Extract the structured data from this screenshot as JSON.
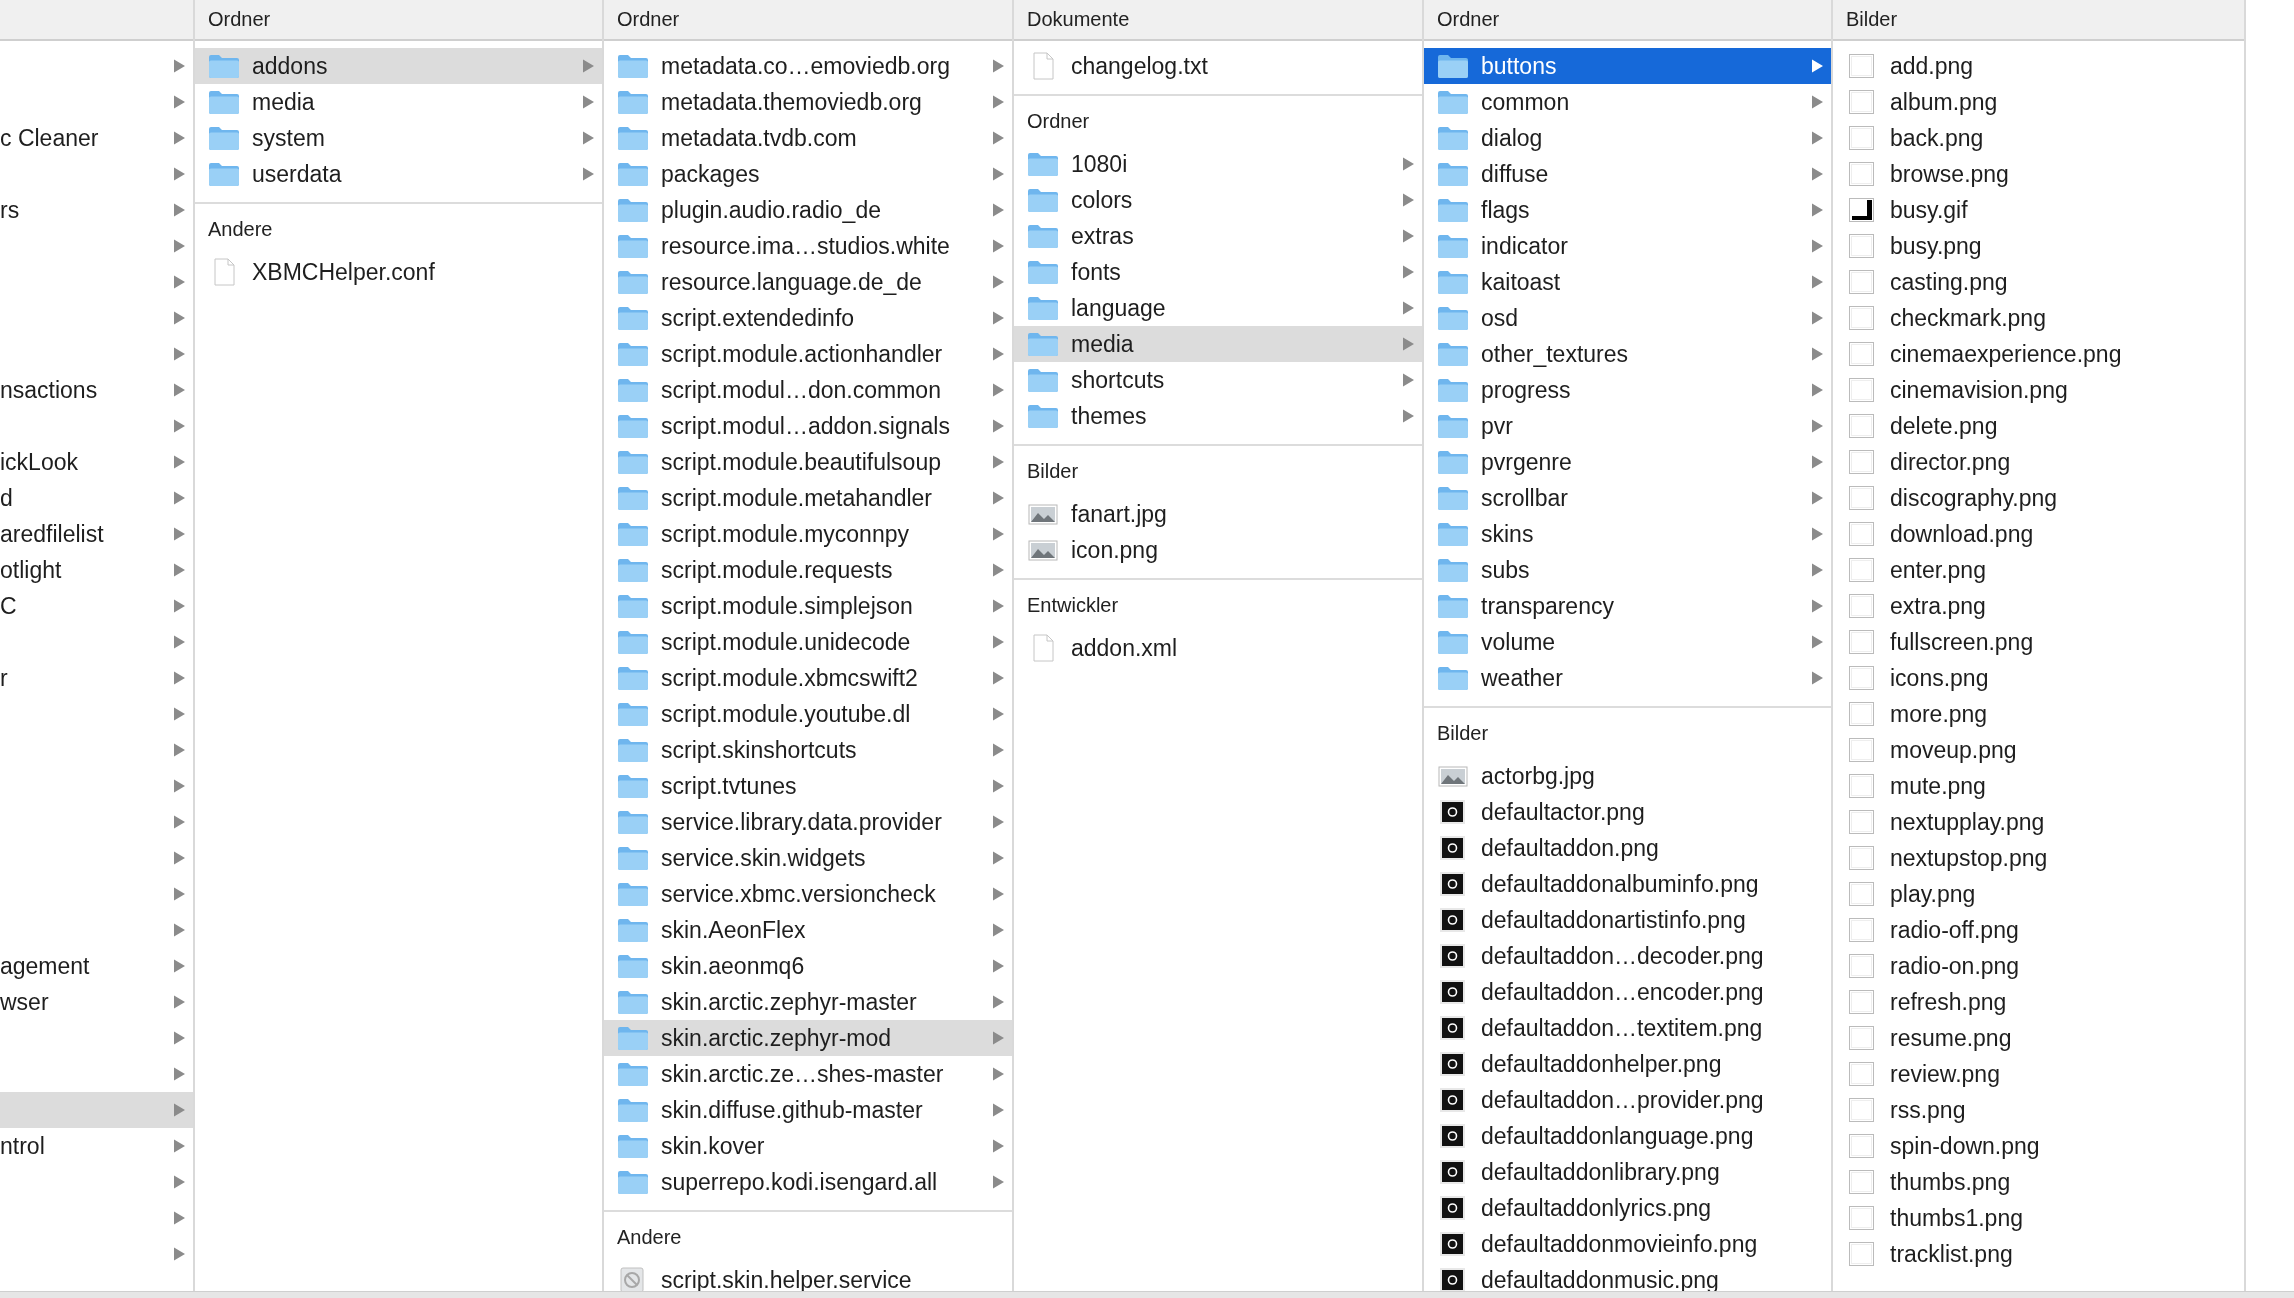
{
  "columns": [
    {
      "sections": [
        {
          "items": [
            {
              "kind": "clipped",
              "selected": false,
              "has_children": true
            },
            {
              "kind": "clipped",
              "selected": false,
              "has_children": true
            },
            {
              "kind": "clipped",
              "name": "c Cleaner",
              "selected": false,
              "has_children": true
            },
            {
              "kind": "clipped",
              "selected": false,
              "has_children": true
            },
            {
              "kind": "clipped",
              "name": "rs",
              "selected": false,
              "has_children": true
            },
            {
              "kind": "clipped",
              "selected": false,
              "has_children": true
            },
            {
              "kind": "clipped",
              "selected": false,
              "has_children": true
            },
            {
              "kind": "clipped",
              "selected": false,
              "has_children": true
            },
            {
              "kind": "clipped",
              "selected": false,
              "has_children": true
            },
            {
              "kind": "clipped",
              "name": "nsactions",
              "selected": false,
              "has_children": true
            },
            {
              "kind": "clipped",
              "selected": false,
              "has_children": true
            },
            {
              "kind": "clipped",
              "name": "ickLook",
              "selected": false,
              "has_children": true
            },
            {
              "kind": "clipped",
              "name": "d",
              "selected": false,
              "has_children": true
            },
            {
              "kind": "clipped",
              "name": "aredfilelist",
              "selected": false,
              "has_children": true
            },
            {
              "kind": "clipped",
              "name": "otlight",
              "selected": false,
              "has_children": true
            },
            {
              "kind": "clipped",
              "name": "C",
              "selected": false,
              "has_children": true
            },
            {
              "kind": "clipped",
              "selected": false,
              "has_children": true
            },
            {
              "kind": "clipped",
              "name": "r",
              "selected": false,
              "has_children": true
            },
            {
              "kind": "clipped",
              "selected": false,
              "has_children": true
            },
            {
              "kind": "clipped",
              "selected": false,
              "has_children": true
            },
            {
              "kind": "clipped",
              "selected": false,
              "has_children": true
            },
            {
              "kind": "clipped",
              "selected": false,
              "has_children": true
            },
            {
              "kind": "clipped",
              "selected": false,
              "has_children": true
            },
            {
              "kind": "clipped",
              "selected": false,
              "has_children": true
            },
            {
              "kind": "clipped",
              "selected": false,
              "has_children": true
            },
            {
              "kind": "clipped",
              "name": "agement",
              "selected": false,
              "has_children": true
            },
            {
              "kind": "clipped",
              "name": "wser",
              "selected": false,
              "has_children": true
            },
            {
              "kind": "clipped",
              "selected": false,
              "has_children": true
            },
            {
              "kind": "clipped",
              "selected": false,
              "has_children": true
            },
            {
              "kind": "clipped",
              "selected": true,
              "has_children": true
            },
            {
              "kind": "clipped",
              "name": "ntrol",
              "selected": false,
              "has_children": true
            },
            {
              "kind": "clipped",
              "selected": false,
              "has_children": true
            },
            {
              "kind": "clipped",
              "selected": false,
              "has_children": true
            },
            {
              "kind": "clipped",
              "selected": false,
              "has_children": true
            }
          ]
        }
      ]
    },
    {
      "sections": [
        {
          "heading": "Ordner",
          "items": [
            {
              "kind": "folder",
              "name": "addons",
              "selected": true,
              "has_children": true
            },
            {
              "kind": "folder",
              "name": "media",
              "selected": false,
              "has_children": true
            },
            {
              "kind": "folder",
              "name": "system",
              "selected": false,
              "has_children": true
            },
            {
              "kind": "folder",
              "name": "userdata",
              "selected": false,
              "has_children": true
            }
          ]
        },
        {
          "heading": "Andere",
          "items": [
            {
              "kind": "document",
              "name": "XBMCHelper.conf",
              "selected": false,
              "has_children": false
            }
          ]
        }
      ]
    },
    {
      "sections": [
        {
          "heading": "Ordner",
          "items": [
            {
              "kind": "folder",
              "name": "metadata.co…emoviedb.org",
              "selected": false,
              "has_children": true
            },
            {
              "kind": "folder",
              "name": "metadata.themoviedb.org",
              "selected": false,
              "has_children": true
            },
            {
              "kind": "folder",
              "name": "metadata.tvdb.com",
              "selected": false,
              "has_children": true
            },
            {
              "kind": "folder",
              "name": "packages",
              "selected": false,
              "has_children": true
            },
            {
              "kind": "folder",
              "name": "plugin.audio.radio_de",
              "selected": false,
              "has_children": true
            },
            {
              "kind": "folder",
              "name": "resource.ima…studios.white",
              "selected": false,
              "has_children": true
            },
            {
              "kind": "folder",
              "name": "resource.language.de_de",
              "selected": false,
              "has_children": true
            },
            {
              "kind": "folder",
              "name": "script.extendedinfo",
              "selected": false,
              "has_children": true
            },
            {
              "kind": "folder",
              "name": "script.module.actionhandler",
              "selected": false,
              "has_children": true
            },
            {
              "kind": "folder",
              "name": "script.modul…don.common",
              "selected": false,
              "has_children": true
            },
            {
              "kind": "folder",
              "name": "script.modul…addon.signals",
              "selected": false,
              "has_children": true
            },
            {
              "kind": "folder",
              "name": "script.module.beautifulsoup",
              "selected": false,
              "has_children": true
            },
            {
              "kind": "folder",
              "name": "script.module.metahandler",
              "selected": false,
              "has_children": true
            },
            {
              "kind": "folder",
              "name": "script.module.myconnpy",
              "selected": false,
              "has_children": true
            },
            {
              "kind": "folder",
              "name": "script.module.requests",
              "selected": false,
              "has_children": true
            },
            {
              "kind": "folder",
              "name": "script.module.simplejson",
              "selected": false,
              "has_children": true
            },
            {
              "kind": "folder",
              "name": "script.module.unidecode",
              "selected": false,
              "has_children": true
            },
            {
              "kind": "folder",
              "name": "script.module.xbmcswift2",
              "selected": false,
              "has_children": true
            },
            {
              "kind": "folder",
              "name": "script.module.youtube.dl",
              "selected": false,
              "has_children": true
            },
            {
              "kind": "folder",
              "name": "script.skinshortcuts",
              "selected": false,
              "has_children": true
            },
            {
              "kind": "folder",
              "name": "script.tvtunes",
              "selected": false,
              "has_children": true
            },
            {
              "kind": "folder",
              "name": "service.library.data.provider",
              "selected": false,
              "has_children": true
            },
            {
              "kind": "folder",
              "name": "service.skin.widgets",
              "selected": false,
              "has_children": true
            },
            {
              "kind": "folder",
              "name": "service.xbmc.versioncheck",
              "selected": false,
              "has_children": true
            },
            {
              "kind": "folder",
              "name": "skin.AeonFlex",
              "selected": false,
              "has_children": true
            },
            {
              "kind": "folder",
              "name": "skin.aeonmq6",
              "selected": false,
              "has_children": true
            },
            {
              "kind": "folder",
              "name": "skin.arctic.zephyr-master",
              "selected": false,
              "has_children": true
            },
            {
              "kind": "folder",
              "name": "skin.arctic.zephyr-mod",
              "selected": true,
              "has_children": true
            },
            {
              "kind": "folder",
              "name": "skin.arctic.ze…shes-master",
              "selected": false,
              "has_children": true
            },
            {
              "kind": "folder",
              "name": "skin.diffuse.github-master",
              "selected": false,
              "has_children": true
            },
            {
              "kind": "folder",
              "name": "skin.kover",
              "selected": false,
              "has_children": true
            },
            {
              "kind": "folder",
              "name": "superrepo.kodi.isengard.all",
              "selected": false,
              "has_children": true
            }
          ]
        },
        {
          "heading": "Andere",
          "items": [
            {
              "kind": "app",
              "name": "script.skin.helper.service",
              "selected": false,
              "has_children": false
            }
          ]
        }
      ]
    },
    {
      "sections": [
        {
          "heading": "Dokumente",
          "items": [
            {
              "kind": "document",
              "name": "changelog.txt",
              "selected": false,
              "has_children": false
            }
          ]
        },
        {
          "heading": "Ordner",
          "items": [
            {
              "kind": "folder",
              "name": "1080i",
              "selected": false,
              "has_children": true
            },
            {
              "kind": "folder",
              "name": "colors",
              "selected": false,
              "has_children": true
            },
            {
              "kind": "folder",
              "name": "extras",
              "selected": false,
              "has_children": true
            },
            {
              "kind": "folder",
              "name": "fonts",
              "selected": false,
              "has_children": true
            },
            {
              "kind": "folder",
              "name": "language",
              "selected": false,
              "has_children": true
            },
            {
              "kind": "folder",
              "name": "media",
              "selected": true,
              "has_children": true
            },
            {
              "kind": "folder",
              "name": "shortcuts",
              "selected": false,
              "has_children": true
            },
            {
              "kind": "folder",
              "name": "themes",
              "selected": false,
              "has_children": true
            }
          ]
        },
        {
          "heading": "Bilder",
          "items": [
            {
              "kind": "photo",
              "name": "fanart.jpg",
              "selected": false,
              "has_children": false
            },
            {
              "kind": "photo",
              "name": "icon.png",
              "selected": false,
              "has_children": false
            }
          ]
        },
        {
          "heading": "Entwickler",
          "items": [
            {
              "kind": "document",
              "name": "addon.xml",
              "selected": false,
              "has_children": false
            }
          ]
        }
      ]
    },
    {
      "sections": [
        {
          "heading": "Ordner",
          "items": [
            {
              "kind": "folder",
              "name": "buttons",
              "selected": true,
              "has_children": true
            },
            {
              "kind": "folder",
              "name": "common",
              "selected": false,
              "has_children": true
            },
            {
              "kind": "folder",
              "name": "dialog",
              "selected": false,
              "has_children": true
            },
            {
              "kind": "folder",
              "name": "diffuse",
              "selected": false,
              "has_children": true
            },
            {
              "kind": "folder",
              "name": "flags",
              "selected": false,
              "has_children": true
            },
            {
              "kind": "folder",
              "name": "indicator",
              "selected": false,
              "has_children": true
            },
            {
              "kind": "folder",
              "name": "kaitoast",
              "selected": false,
              "has_children": true
            },
            {
              "kind": "folder",
              "name": "osd",
              "selected": false,
              "has_children": true
            },
            {
              "kind": "folder",
              "name": "other_textures",
              "selected": false,
              "has_children": true
            },
            {
              "kind": "folder",
              "name": "progress",
              "selected": false,
              "has_children": true
            },
            {
              "kind": "folder",
              "name": "pvr",
              "selected": false,
              "has_children": true
            },
            {
              "kind": "folder",
              "name": "pvrgenre",
              "selected": false,
              "has_children": true
            },
            {
              "kind": "folder",
              "name": "scrollbar",
              "selected": false,
              "has_children": true
            },
            {
              "kind": "folder",
              "name": "skins",
              "selected": false,
              "has_children": true
            },
            {
              "kind": "folder",
              "name": "subs",
              "selected": false,
              "has_children": true
            },
            {
              "kind": "folder",
              "name": "transparency",
              "selected": false,
              "has_children": true
            },
            {
              "kind": "folder",
              "name": "volume",
              "selected": false,
              "has_children": true
            },
            {
              "kind": "folder",
              "name": "weather",
              "selected": false,
              "has_children": true
            }
          ]
        },
        {
          "heading": "Bilder",
          "items": [
            {
              "kind": "photo",
              "name": "actorbg.jpg",
              "selected": false,
              "has_children": false
            },
            {
              "kind": "thumb-dark",
              "name": "defaultactor.png",
              "selected": false,
              "has_children": false
            },
            {
              "kind": "thumb-dark",
              "name": "defaultaddon.png",
              "selected": false,
              "has_children": false
            },
            {
              "kind": "thumb-dark",
              "name": "defaultaddonalbuminfo.png",
              "selected": false,
              "has_children": false
            },
            {
              "kind": "thumb-dark",
              "name": "defaultaddonartistinfo.png",
              "selected": false,
              "has_children": false
            },
            {
              "kind": "thumb-dark",
              "name": "defaultaddon…decoder.png",
              "selected": false,
              "has_children": false
            },
            {
              "kind": "thumb-dark",
              "name": "defaultaddon…encoder.png",
              "selected": false,
              "has_children": false
            },
            {
              "kind": "thumb-dark",
              "name": "defaultaddon…textitem.png",
              "selected": false,
              "has_children": false
            },
            {
              "kind": "thumb-dark",
              "name": "defaultaddonhelper.png",
              "selected": false,
              "has_children": false
            },
            {
              "kind": "thumb-dark",
              "name": "defaultaddon…provider.png",
              "selected": false,
              "has_children": false
            },
            {
              "kind": "thumb-dark",
              "name": "defaultaddonlanguage.png",
              "selected": false,
              "has_children": false
            },
            {
              "kind": "thumb-dark",
              "name": "defaultaddonlibrary.png",
              "selected": false,
              "has_children": false
            },
            {
              "kind": "thumb-dark",
              "name": "defaultaddonlyrics.png",
              "selected": false,
              "has_children": false
            },
            {
              "kind": "thumb-dark",
              "name": "defaultaddonmovieinfo.png",
              "selected": false,
              "has_children": false
            },
            {
              "kind": "thumb-dark",
              "name": "defaultaddonmusic.png",
              "selected": false,
              "has_children": false
            }
          ]
        }
      ]
    },
    {
      "sections": [
        {
          "heading": "Bilder",
          "items": [
            {
              "kind": "thumb-blank",
              "name": "add.png",
              "selected": false,
              "has_children": false
            },
            {
              "kind": "thumb-blank",
              "name": "album.png",
              "selected": false,
              "has_children": false
            },
            {
              "kind": "thumb-blank",
              "name": "back.png",
              "selected": false,
              "has_children": false
            },
            {
              "kind": "thumb-blank",
              "name": "browse.png",
              "selected": false,
              "has_children": false
            },
            {
              "kind": "thumb-corner",
              "name": "busy.gif",
              "selected": false,
              "has_children": false
            },
            {
              "kind": "thumb-blank",
              "name": "busy.png",
              "selected": false,
              "has_children": false
            },
            {
              "kind": "thumb-blank",
              "name": "casting.png",
              "selected": false,
              "has_children": false
            },
            {
              "kind": "thumb-blank",
              "name": "checkmark.png",
              "selected": false,
              "has_children": false
            },
            {
              "kind": "thumb-blank",
              "name": "cinemaexperience.png",
              "selected": false,
              "has_children": false
            },
            {
              "kind": "thumb-blank",
              "name": "cinemavision.png",
              "selected": false,
              "has_children": false
            },
            {
              "kind": "thumb-blank",
              "name": "delete.png",
              "selected": false,
              "has_children": false
            },
            {
              "kind": "thumb-blank",
              "name": "director.png",
              "selected": false,
              "has_children": false
            },
            {
              "kind": "thumb-blank",
              "name": "discography.png",
              "selected": false,
              "has_children": false
            },
            {
              "kind": "thumb-blank",
              "name": "download.png",
              "selected": false,
              "has_children": false
            },
            {
              "kind": "thumb-blank",
              "name": "enter.png",
              "selected": false,
              "has_children": false
            },
            {
              "kind": "thumb-blank",
              "name": "extra.png",
              "selected": false,
              "has_children": false
            },
            {
              "kind": "thumb-blank",
              "name": "fullscreen.png",
              "selected": false,
              "has_children": false
            },
            {
              "kind": "thumb-blank",
              "name": "icons.png",
              "selected": false,
              "has_children": false
            },
            {
              "kind": "thumb-blank",
              "name": "more.png",
              "selected": false,
              "has_children": false
            },
            {
              "kind": "thumb-blank",
              "name": "moveup.png",
              "selected": false,
              "has_children": false
            },
            {
              "kind": "thumb-blank",
              "name": "mute.png",
              "selected": false,
              "has_children": false
            },
            {
              "kind": "thumb-blank",
              "name": "nextupplay.png",
              "selected": false,
              "has_children": false
            },
            {
              "kind": "thumb-blank",
              "name": "nextupstop.png",
              "selected": false,
              "has_children": false
            },
            {
              "kind": "thumb-blank",
              "name": "play.png",
              "selected": false,
              "has_children": false
            },
            {
              "kind": "thumb-blank",
              "name": "radio-off.png",
              "selected": false,
              "has_children": false
            },
            {
              "kind": "thumb-blank",
              "name": "radio-on.png",
              "selected": false,
              "has_children": false
            },
            {
              "kind": "thumb-blank",
              "name": "refresh.png",
              "selected": false,
              "has_children": false
            },
            {
              "kind": "thumb-blank",
              "name": "resume.png",
              "selected": false,
              "has_children": false
            },
            {
              "kind": "thumb-blank",
              "name": "review.png",
              "selected": false,
              "has_children": false
            },
            {
              "kind": "thumb-blank",
              "name": "rss.png",
              "selected": false,
              "has_children": false
            },
            {
              "kind": "thumb-blank",
              "name": "spin-down.png",
              "selected": false,
              "has_children": false
            },
            {
              "kind": "thumb-blank",
              "name": "thumbs.png",
              "selected": false,
              "has_children": false
            },
            {
              "kind": "thumb-blank",
              "name": "thumbs1.png",
              "selected": false,
              "has_children": false
            },
            {
              "kind": "thumb-blank",
              "name": "tracklist.png",
              "selected": false,
              "has_children": false
            }
          ]
        }
      ]
    }
  ]
}
